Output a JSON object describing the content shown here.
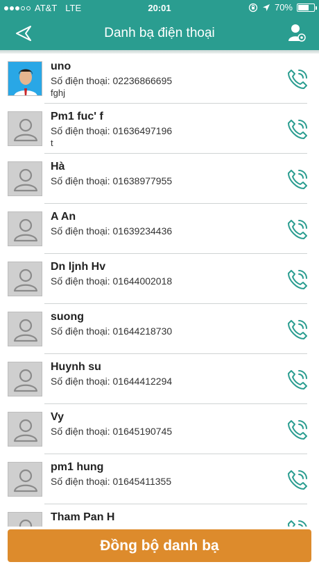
{
  "status": {
    "carrier": "AT&T",
    "network": "LTE",
    "time": "20:01",
    "battery": "70%",
    "battery_level": 0.7
  },
  "header": {
    "title": "Danh bạ điện thoại",
    "back_icon": "back-arrow-icon",
    "user_icon": "user-settings-icon"
  },
  "contacts": [
    {
      "name": "uno",
      "phone": "Số điện thoại: 02236866695",
      "note": "fghj"
    },
    {
      "name": "Pm1 fuc' f",
      "phone": "Số điện thoại: 01636497196",
      "note": "t"
    },
    {
      "name": "Hà",
      "phone": "Số điện thoại: 01638977955",
      "note": ""
    },
    {
      "name": "A An",
      "phone": "Số điện thoại: 01639234436",
      "note": ""
    },
    {
      "name": "Dn ljnh Hv",
      "phone": "Số điện thoại: 01644002018",
      "note": ""
    },
    {
      "name": "suong",
      "phone": "Số điện thoại: 01644218730",
      "note": ""
    },
    {
      "name": "Huynh su",
      "phone": "Số điện thoại: 01644412294",
      "note": ""
    },
    {
      "name": "Vy",
      "phone": "Số điện thoại: 01645190745",
      "note": ""
    },
    {
      "name": "pm1 hung",
      "phone": "Số điện thoại: 01645411355",
      "note": ""
    },
    {
      "name": "Tham Pan H",
      "phone": "",
      "note": ""
    }
  ],
  "sync_button": {
    "label": "Đồng bộ danh bạ"
  },
  "colors": {
    "primary": "#2a9d90",
    "accent": "#dd8b2c",
    "call_icon": "#2a9d90"
  }
}
